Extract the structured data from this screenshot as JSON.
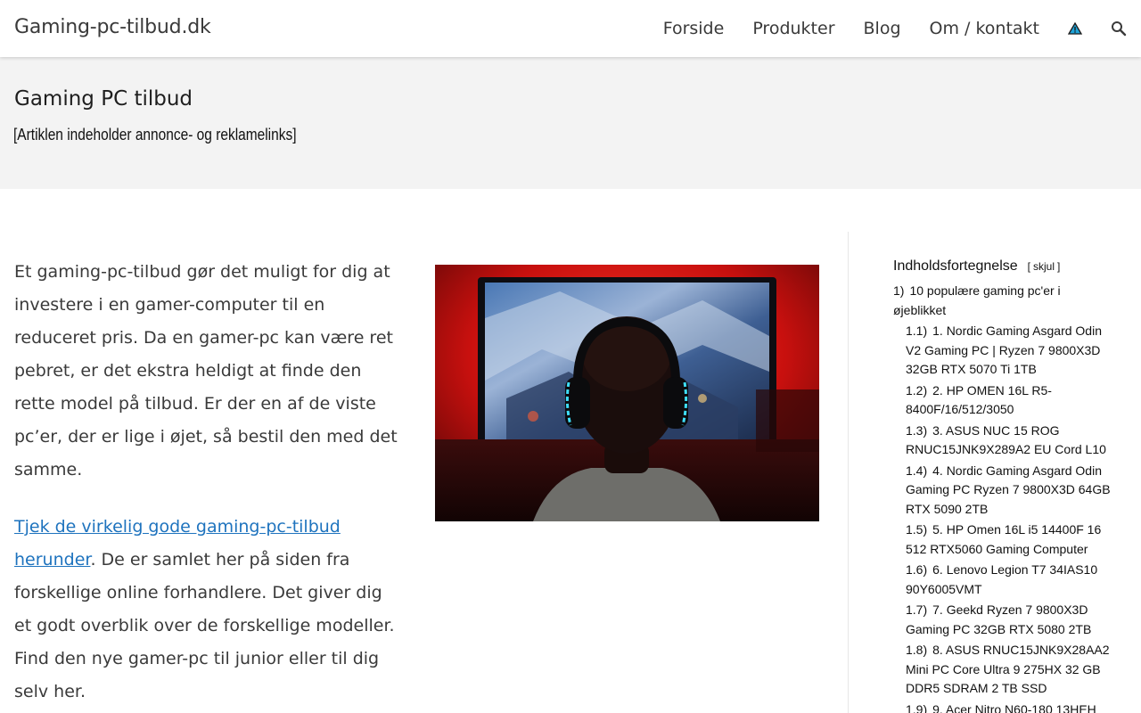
{
  "site": {
    "title": "Gaming-pc-tilbud.dk"
  },
  "nav": {
    "items": [
      "Forside",
      "Produkter",
      "Blog",
      "Om / kontakt"
    ],
    "icons": [
      "warning-triangle-icon",
      "search-icon"
    ]
  },
  "page": {
    "title": "Gaming PC tilbud",
    "disclaimer": "[Artiklen indeholder annonce- og reklamelinks]"
  },
  "content": {
    "para1": "Et gaming-pc-tilbud gør det muligt for dig at investere i en gamer-computer til en reduceret pris. Da en gamer-pc kan være ret pebret, er det ekstra heldigt at finde den rette model på tilbud. Er der en af de viste pc’er, der er lige i øjet, så bestil den med det samme.",
    "para2_link": "Tjek de virkelig gode gaming-pc-tilbud herunder",
    "para2_rest": ". De er samlet her på siden fra forskellige online forhandlere. Det giver dig et godt overblik over de forskellige modeller. Find den nye gamer-pc til junior eller til dig selv her.",
    "image_alt": "gamer-with-headphones-photo"
  },
  "toc": {
    "title": "Indholdsfortegnelse",
    "toggle_label": "skjul",
    "items": [
      {
        "num": "1)",
        "text": "10 populære gaming pc'er i øjeblikket"
      },
      {
        "num": "1.1)",
        "text": "1. Nordic Gaming Asgard Odin V2 Gaming PC | Ryzen 7 9800X3D 32GB RTX 5070 Ti 1TB"
      },
      {
        "num": "1.2)",
        "text": "2. HP OMEN 16L R5-8400F/16/512/3050"
      },
      {
        "num": "1.3)",
        "text": "3. ASUS NUC 15 ROG RNUC15JNK9X289A2 EU Cord L10"
      },
      {
        "num": "1.4)",
        "text": "4. Nordic Gaming Asgard Odin Gaming PC Ryzen 7 9800X3D 64GB RTX 5090 2TB"
      },
      {
        "num": "1.5)",
        "text": "5. HP Omen 16L i5 14400F 16 512 RTX5060 Gaming Computer"
      },
      {
        "num": "1.6)",
        "text": "6. Lenovo Legion T7 34IAS10 90Y6005VMT"
      },
      {
        "num": "1.7)",
        "text": "7. Geekd Ryzen 7 9800X3D Gaming PC 32GB RTX 5080 2TB"
      },
      {
        "num": "1.8)",
        "text": "8. ASUS RNUC15JNK9X28AA2 Mini PC Core Ultra 9 275HX 32 GB DDR5 SDRAM 2 TB SSD"
      },
      {
        "num": "1.9)",
        "text": "9. Acer Nitro N60-180 13HEH"
      }
    ]
  },
  "colors": {
    "link": "#1e73be",
    "title_band": "#f3f3f3",
    "text": "#3a3a3a",
    "warning_icon": "#1fa3d8"
  }
}
